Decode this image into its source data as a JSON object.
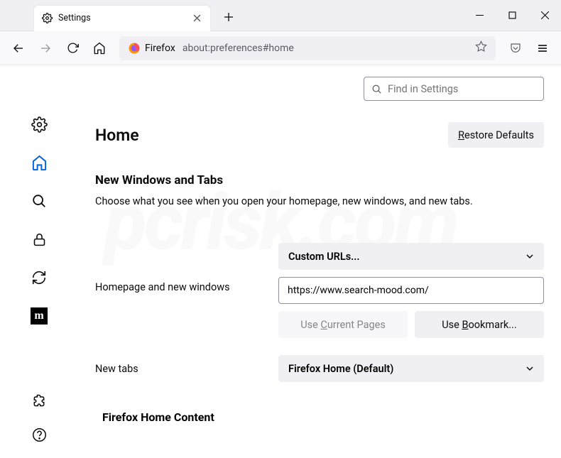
{
  "window": {
    "tab_title": "Settings",
    "urlbar_context": "Firefox",
    "url": "about:preferences#home"
  },
  "search": {
    "placeholder": "Find in Settings"
  },
  "page": {
    "heading": "Home",
    "restore_btn": "Restore Defaults",
    "section1_title": "New Windows and Tabs",
    "section1_desc": "Choose what you see when you open your homepage, new windows, and new tabs.",
    "homepage_label": "Homepage and new windows",
    "homepage_dropdown": "Custom URLs...",
    "homepage_url_value": "https://www.search-mood.com/",
    "use_current": "Use Current Pages",
    "use_bookmark": "Use Bookmark...",
    "newtabs_label": "New tabs",
    "newtabs_dropdown": "Firefox Home (Default)",
    "section2_title": "Firefox Home Content"
  }
}
